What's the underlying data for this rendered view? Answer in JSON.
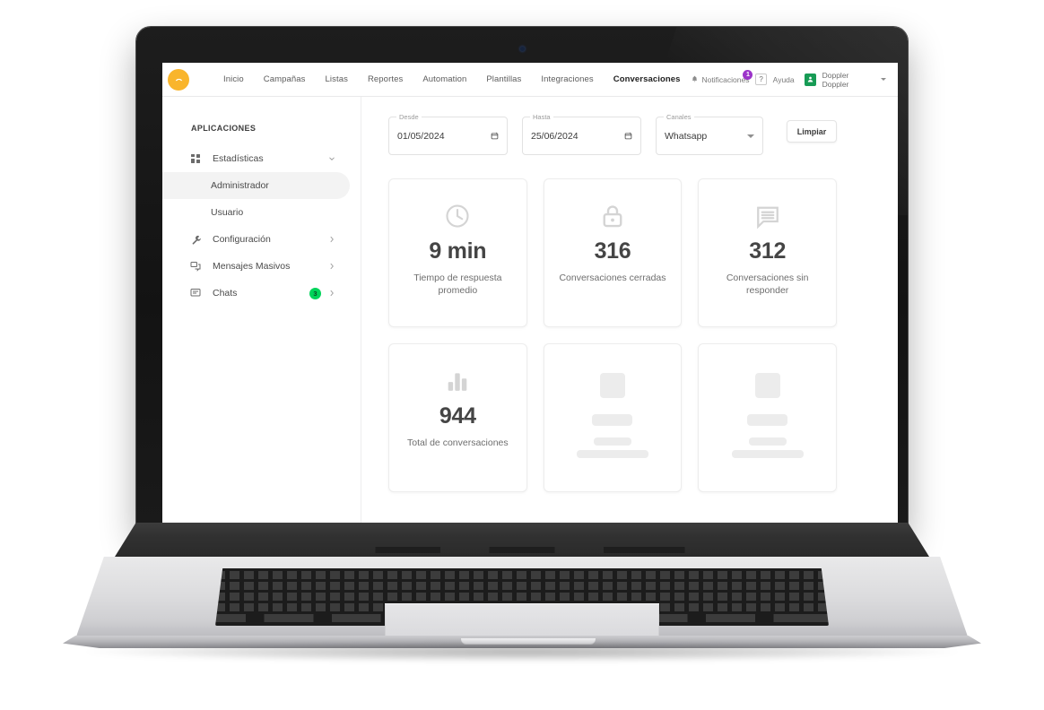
{
  "navbar": {
    "logo_icon": "doppler-logo-icon",
    "logo_color": "#f9b52c",
    "links": [
      {
        "label": "Inicio",
        "active": false
      },
      {
        "label": "Campañas",
        "active": false
      },
      {
        "label": "Listas",
        "active": false
      },
      {
        "label": "Reportes",
        "active": false
      },
      {
        "label": "Automation",
        "active": false
      },
      {
        "label": "Plantillas",
        "active": false
      },
      {
        "label": "Integraciones",
        "active": false
      },
      {
        "label": "Conversaciones",
        "active": true
      }
    ],
    "notifications_label": "Notificaciones",
    "notifications_count": "1",
    "notifications_badge_color": "#9b34c9",
    "help_label": "Ayuda",
    "help_icon": "question-mark-icon",
    "user_name": "Doppler Doppler",
    "avatar_color": "#179b55"
  },
  "sidebar": {
    "title": "APLICACIONES",
    "items": [
      {
        "label": "Estadísticas",
        "icon": "dashboard-grid-icon",
        "chevron": "down",
        "active": false,
        "sub": false,
        "badge": null
      },
      {
        "label": "Administrador",
        "icon": null,
        "chevron": null,
        "active": true,
        "sub": true,
        "badge": null
      },
      {
        "label": "Usuario",
        "icon": null,
        "chevron": null,
        "active": false,
        "sub": true,
        "badge": null
      },
      {
        "label": "Configuración",
        "icon": "wrench-icon",
        "chevron": "right",
        "active": false,
        "sub": false,
        "badge": null
      },
      {
        "label": "Mensajes Masivos",
        "icon": "bulk-message-icon",
        "chevron": "right",
        "active": false,
        "sub": false,
        "badge": null
      },
      {
        "label": "Chats",
        "icon": "chat-icon",
        "chevron": "right",
        "active": false,
        "sub": false,
        "badge": "3"
      }
    ],
    "badge_color": "#00d45a"
  },
  "filters": {
    "from": {
      "legend": "Desde",
      "value": "01/05/2024",
      "icon": "calendar-icon"
    },
    "to": {
      "legend": "Hasta",
      "value": "25/06/2024",
      "icon": "calendar-icon"
    },
    "channel": {
      "legend": "Canales",
      "value": "Whatsapp",
      "icon": "chevron-down-icon"
    },
    "clear_button": "Limpiar"
  },
  "cards": [
    {
      "value": "9 min",
      "label": "Tiempo de respuesta promedio",
      "icon": "clock-icon",
      "skeleton": false
    },
    {
      "value": "316",
      "label": "Conversaciones cerradas",
      "icon": "lock-icon",
      "skeleton": false
    },
    {
      "value": "312",
      "label": "Conversaciones sin responder",
      "icon": "message-bubble-icon",
      "skeleton": false
    },
    {
      "value": "944",
      "label": "Total de conversaciones",
      "icon": "bar-chart-icon",
      "skeleton": false
    },
    {
      "value": "",
      "label": "",
      "icon": null,
      "skeleton": true
    },
    {
      "value": "",
      "label": "",
      "icon": null,
      "skeleton": true
    }
  ]
}
